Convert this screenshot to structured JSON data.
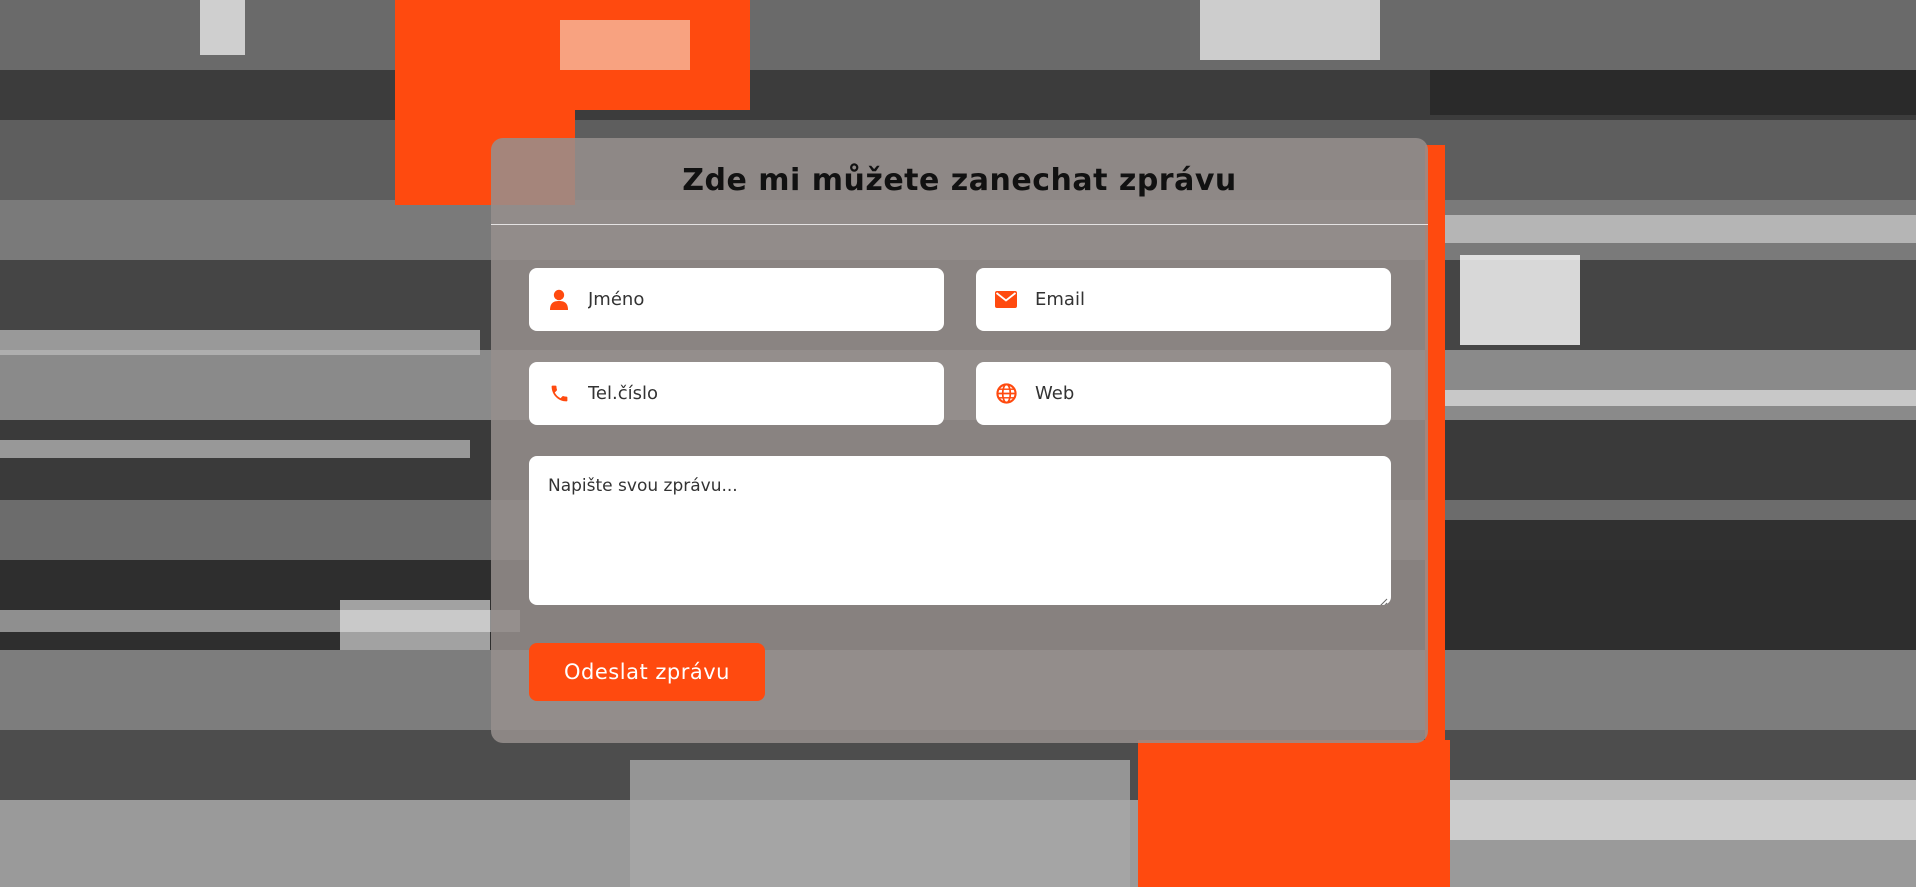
{
  "form": {
    "title": "Zde mi můžete zanechat zprávu",
    "fields": [
      {
        "placeholder": "Jméno",
        "icon": "user-icon"
      },
      {
        "placeholder": "Email",
        "icon": "envelope-icon"
      },
      {
        "placeholder": "Tel.číslo",
        "icon": "phone-icon"
      },
      {
        "placeholder": "Web",
        "icon": "globe-icon"
      }
    ],
    "message_placeholder": "Napište svou zprávu...",
    "submit_label": "Odeslat zprávu"
  },
  "colors": {
    "accent": "#ff4a0f",
    "card_background": "#968f8d",
    "field_background": "#ffffff",
    "title_text": "#111111"
  }
}
